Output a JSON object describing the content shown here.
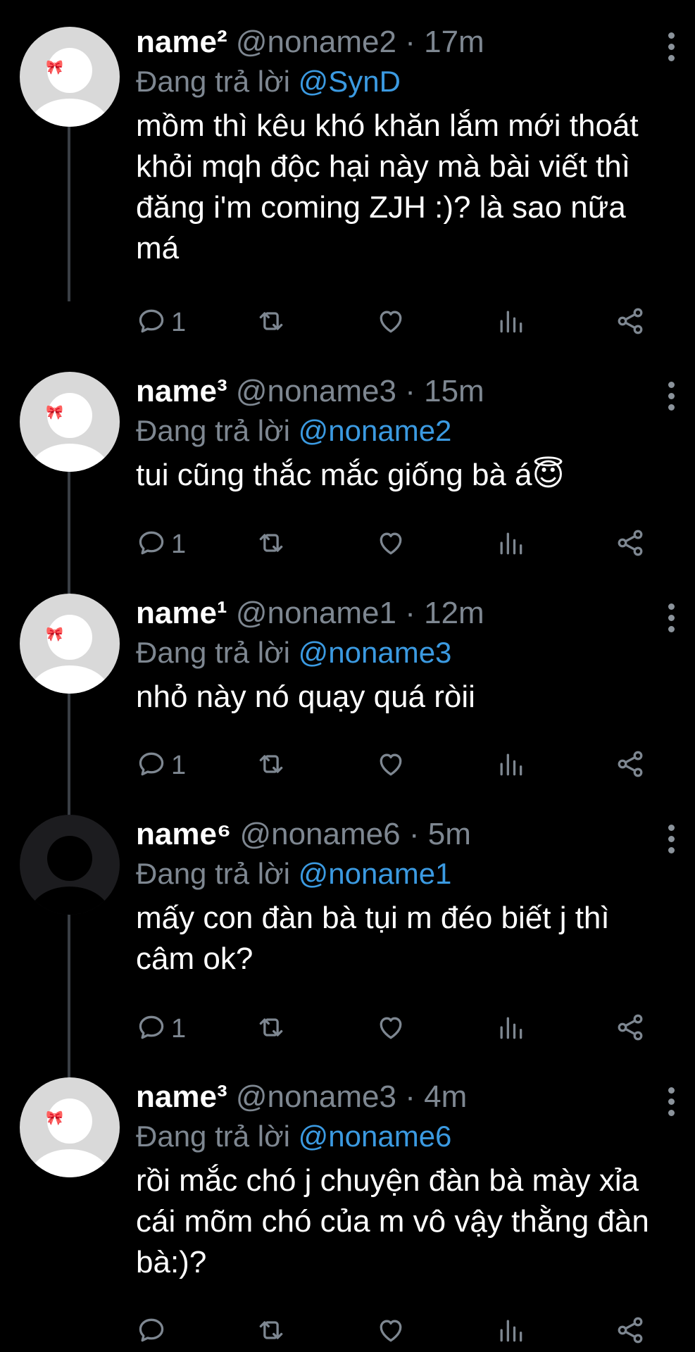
{
  "tweets": [
    {
      "name": "name²",
      "handle": "@noname2",
      "time": "17m",
      "reply_prefix": "Đang trả lời",
      "reply_to": "@SynD",
      "text": "mồm thì kêu khó khăn lắm mới thoát khỏi mqh độc hại này mà bài viết thì đăng i'm coming ZJH :)? là sao nữa má",
      "reply_count": "1",
      "avatar_style": "light"
    },
    {
      "name": "name³",
      "handle": "@noname3",
      "time": "15m",
      "reply_prefix": "Đang trả lời",
      "reply_to": "@noname2",
      "text": "tui cũng thắc mắc giống bà á😇",
      "reply_count": "1",
      "avatar_style": "light"
    },
    {
      "name": "name¹",
      "handle": "@noname1",
      "time": "12m",
      "reply_prefix": "Đang trả lời",
      "reply_to": "@noname3",
      "text": "nhỏ này nó quạy quá ròii",
      "reply_count": "1",
      "avatar_style": "light"
    },
    {
      "name": "name⁶",
      "handle": "@noname6",
      "time": "5m",
      "reply_prefix": "Đang trả lời",
      "reply_to": "@noname1",
      "text": "mấy con đàn bà tụi m đéo biết j thì câm ok?",
      "reply_count": "1",
      "avatar_style": "dark"
    },
    {
      "name": "name³",
      "handle": "@noname3",
      "time": "4m",
      "reply_prefix": "Đang trả lời",
      "reply_to": "@noname6",
      "text": "rồi mắc chó j chuyện đàn bà mày xỉa cái mõm chó của m vô vậy thằng đàn bà:)?",
      "reply_count": "",
      "avatar_style": "light"
    }
  ],
  "icons": {
    "reply": "reply-bubble-icon",
    "retweet": "retweet-icon",
    "like": "heart-icon",
    "analytics": "analytics-icon",
    "share": "share-icon",
    "more": "more-vertical-icon"
  },
  "colors": {
    "background": "#000000",
    "secondary_text": "#7e8791",
    "mention": "#3b9ae1"
  }
}
